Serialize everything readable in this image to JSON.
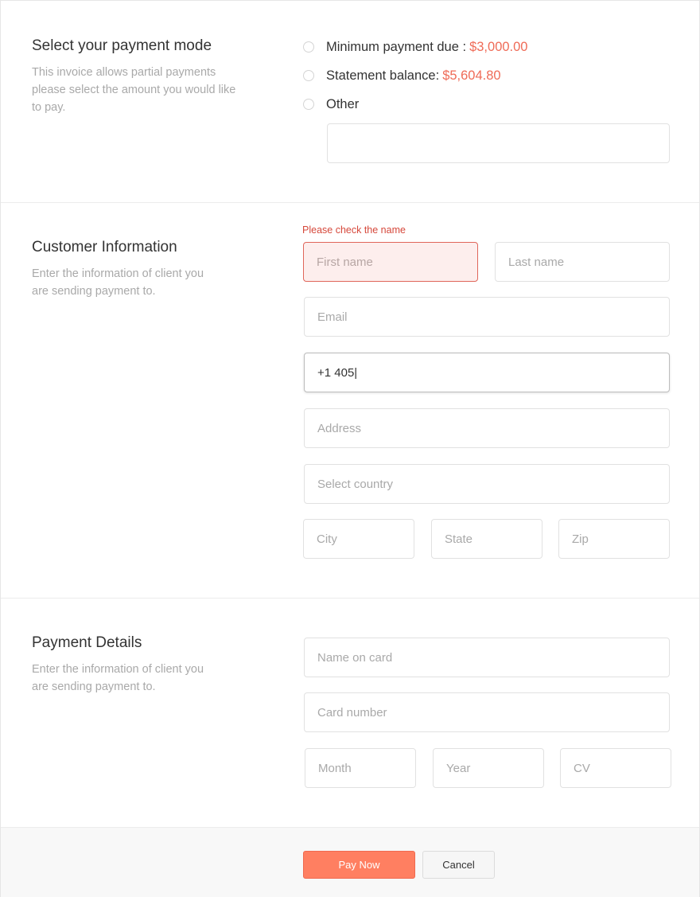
{
  "payment_mode": {
    "title": "Select your payment mode",
    "description": "This invoice allows partial payments please select the amount you would like to pay.",
    "options": [
      {
        "label": "Minimum payment due :",
        "amount": "$3,000.00"
      },
      {
        "label": "Statement balance:",
        "amount": "$5,604.80"
      },
      {
        "label": "Other",
        "amount": ""
      }
    ],
    "other_value": ""
  },
  "customer": {
    "title": "Customer Information",
    "description": "Enter the information of client you are sending payment to.",
    "error_message": "Please check the name",
    "first_name_placeholder": "First name",
    "last_name_placeholder": "Last name",
    "email_placeholder": "Email",
    "phone_value": "+1 405|",
    "address_placeholder": "Address",
    "country_placeholder": "Select country",
    "city_placeholder": "City",
    "state_placeholder": "State",
    "zip_placeholder": "Zip"
  },
  "payment_details": {
    "title": "Payment Details",
    "description": "Enter the information of client you are sending payment to.",
    "name_on_card_placeholder": "Name on card",
    "card_number_placeholder": "Card number",
    "month_placeholder": "Month",
    "year_placeholder": "Year",
    "cv_placeholder": "CV"
  },
  "footer": {
    "pay_label": "Pay Now",
    "cancel_label": "Cancel"
  },
  "colors": {
    "accent": "#ff7f61",
    "amount": "#ef6b57",
    "error": "#d6483b"
  }
}
